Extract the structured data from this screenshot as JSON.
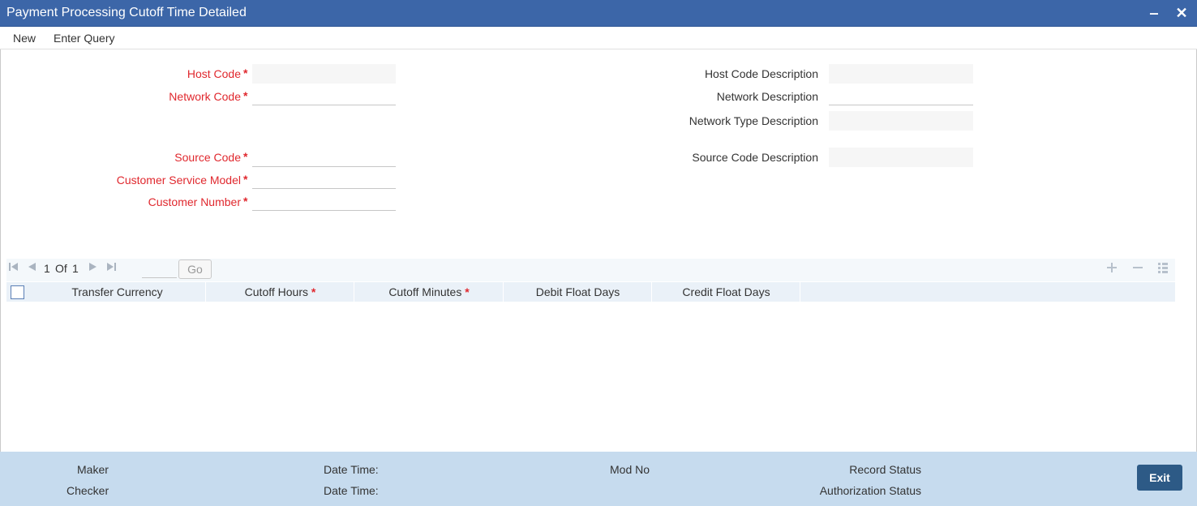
{
  "window": {
    "title": "Payment Processing Cutoff Time Detailed",
    "minimize_glyph": "‒",
    "close_glyph": "✕"
  },
  "menu": {
    "new_label": "New",
    "enter_query_label": "Enter Query"
  },
  "form": {
    "host_code_label": "Host Code",
    "network_code_label": "Network Code",
    "source_code_label": "Source Code",
    "customer_service_model_label": "Customer Service Model",
    "customer_number_label": "Customer Number",
    "host_code_description_label": "Host Code Description",
    "network_description_label": "Network Description",
    "network_type_description_label": "Network Type Description",
    "source_code_description_label": "Source Code Description",
    "required_marker": "*",
    "host_code_value": "",
    "network_code_value": "",
    "source_code_value": "",
    "customer_service_model_value": "",
    "customer_number_value": "",
    "host_code_description_value": "",
    "network_description_value": "",
    "network_type_description_value": "",
    "source_code_description_value": ""
  },
  "grid": {
    "page_current": "1",
    "page_of": "Of",
    "page_total": "1",
    "go_label": "Go",
    "columns": {
      "transfer_currency": "Transfer Currency",
      "cutoff_hours": "Cutoff Hours",
      "cutoff_minutes": "Cutoff Minutes",
      "debit_float_days": "Debit Float Days",
      "credit_float_days": "Credit Float Days"
    },
    "required_marker": "*",
    "icons": {
      "first": "first-page-icon",
      "prev": "previous-page-icon",
      "next": "next-page-icon",
      "last": "last-page-icon",
      "add": "add-row-icon",
      "delete": "delete-row-icon",
      "details": "row-details-icon"
    }
  },
  "footer": {
    "maker_label": "Maker",
    "checker_label": "Checker",
    "date_time_label_1": "Date Time:",
    "date_time_label_2": "Date Time:",
    "mod_no_label": "Mod No",
    "record_status_label": "Record Status",
    "authorization_status_label": "Authorization Status",
    "exit_label": "Exit"
  },
  "colors": {
    "title_bar": "#3c66a8",
    "required_label": "#e0282e",
    "footer_bg": "#c6dbee",
    "exit_button": "#2d5a86",
    "grid_header": "#eaf1f8"
  }
}
